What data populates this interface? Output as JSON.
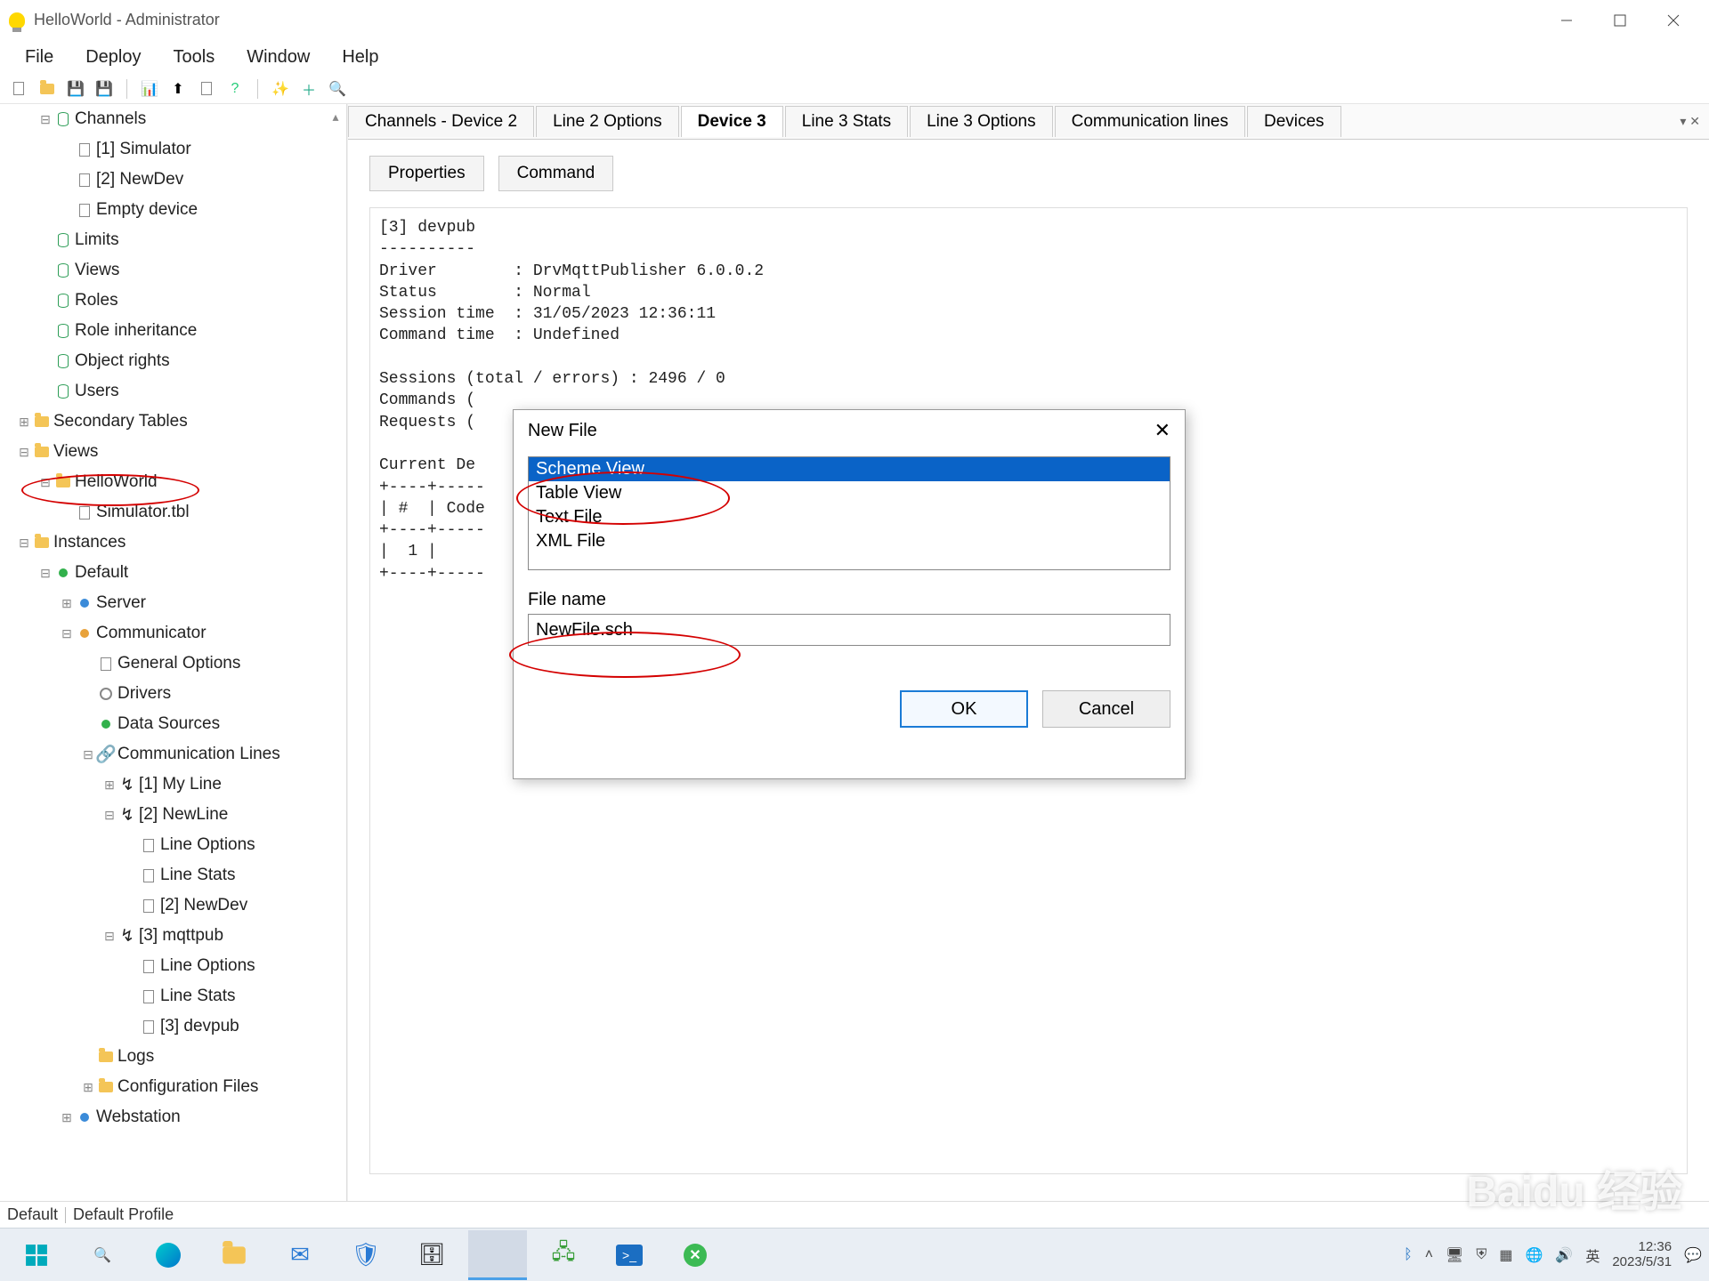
{
  "window": {
    "title": "HelloWorld - Administrator"
  },
  "menu": {
    "items": [
      "File",
      "Deploy",
      "Tools",
      "Window",
      "Help"
    ]
  },
  "tree": {
    "channels": {
      "label": "Channels",
      "items": [
        "[1] Simulator",
        "[2] NewDev",
        "Empty device"
      ]
    },
    "limits": "Limits",
    "views_node": "Views",
    "roles": "Roles",
    "role_inheritance": "Role inheritance",
    "object_rights": "Object rights",
    "users": "Users",
    "secondary_tables": "Secondary Tables",
    "views": {
      "label": "Views",
      "hello": "HelloWorld",
      "sim": "Simulator.tbl"
    },
    "instances": {
      "label": "Instances",
      "default": "Default",
      "server": "Server",
      "communicator": {
        "label": "Communicator",
        "general": "General Options",
        "drivers": "Drivers",
        "data_sources": "Data Sources",
        "lines": {
          "label": "Communication Lines",
          "l1": "[1] My Line",
          "l2": {
            "label": "[2] NewLine",
            "opts": "Line Options",
            "stats": "Line Stats",
            "dev": "[2] NewDev"
          },
          "l3": {
            "label": "[3] mqttpub",
            "opts": "Line Options",
            "stats": "Line Stats",
            "dev": "[3] devpub"
          }
        },
        "logs": "Logs",
        "config": "Configuration Files"
      },
      "webstation": "Webstation"
    }
  },
  "tabs": {
    "items": [
      "Channels - Device 2",
      "Line 2 Options",
      "Device 3",
      "Line 3 Stats",
      "Line 3 Options",
      "Communication lines",
      "Devices"
    ],
    "active": 2
  },
  "pane": {
    "properties": "Properties",
    "command": "Command",
    "text": "[3] devpub\n----------\nDriver        : DrvMqttPublisher 6.0.0.2\nStatus        : Normal\nSession time  : 31/05/2023 12:36:11\nCommand time  : Undefined\n\nSessions (total / errors) : 2496 / 0\nCommands (\nRequests (\n\nCurrent De\n+----+-----\n| #  | Code\n+----+-----\n|  1 |\n+----+-----"
  },
  "dialog": {
    "title": "New File",
    "options": [
      "Scheme View",
      "Table View",
      "Text File",
      "XML File"
    ],
    "selected": 0,
    "fname_label": "File name",
    "fname_value": "NewFile.sch",
    "ok": "OK",
    "cancel": "Cancel"
  },
  "status": {
    "left": "Default",
    "right": "Default Profile"
  },
  "taskbar": {
    "ime": "英",
    "time": "12:36",
    "date": "2023/5/31"
  },
  "watermark": "Baidu 经验"
}
